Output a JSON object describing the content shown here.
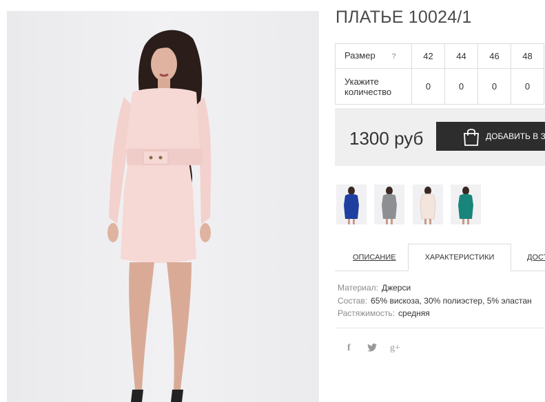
{
  "product": {
    "title": "ПЛАТЬЕ 10024/1"
  },
  "size_table": {
    "size_label": "Размер",
    "help_glyph": "?",
    "sizes": [
      "42",
      "44",
      "46",
      "48"
    ],
    "quantity_label": "Укажите количество",
    "quantities": [
      "0",
      "0",
      "0",
      "0"
    ]
  },
  "purchase": {
    "price": "1300 руб",
    "add_to_cart": "ДОБАВИТЬ В ЗА"
  },
  "color_variants": [
    {
      "color": "#1f3fa0",
      "name": "blue"
    },
    {
      "color": "#8d8f93",
      "name": "grey"
    },
    {
      "color": "#f3e4dc",
      "name": "cream"
    },
    {
      "color": "#17857a",
      "name": "teal"
    }
  ],
  "tabs": [
    {
      "label": "ОПИСАНИЕ",
      "active": false
    },
    {
      "label": "ХАРАКТЕРИСТИКИ",
      "active": true
    },
    {
      "label": "ДОСТ",
      "active": false
    }
  ],
  "specs": [
    {
      "key": "Материал:",
      "value": "Джерси"
    },
    {
      "key": "Состав:",
      "value": "65% вискоза, 30% полиэстер, 5% эластан"
    },
    {
      "key": "Растяжимость:",
      "value": "средняя"
    }
  ],
  "social": {
    "facebook": "f",
    "twitter": "🐦",
    "google_plus": "g+"
  },
  "colors": {
    "main_dress": "#f6d8d4",
    "cart_button": "#2d2d2d",
    "price_box": "#efefef"
  }
}
